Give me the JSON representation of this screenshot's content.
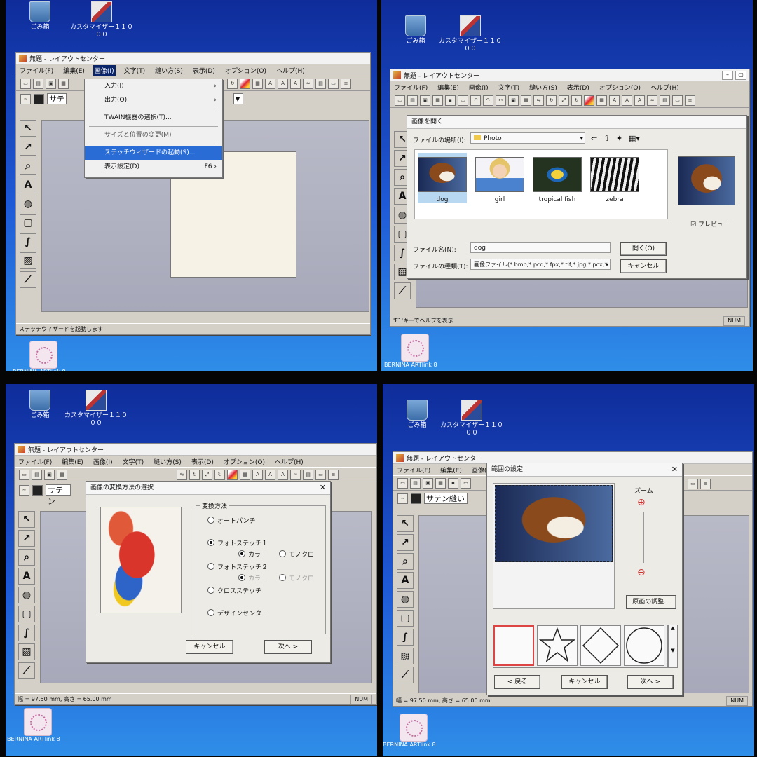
{
  "desktop": {
    "trash_label": "ごみ箱",
    "customizer_label": "カスタマイザー１１０",
    "customizer_sub": "００",
    "artlink_label": "BERNINA ARTlink 8"
  },
  "app": {
    "title": "無題 - レイアウトセンター",
    "menu": [
      "ファイル(F)",
      "編集(E)",
      "画像(I)",
      "文字(T)",
      "縫い方(S)",
      "表示(D)",
      "オプション(O)",
      "ヘルプ(H)"
    ],
    "stitch_combo_full": "サテン縫い",
    "stitch_combo_short": "サテ",
    "stitch_combo_p3": "サテン"
  },
  "panel1": {
    "image_menu": {
      "input": "入力(I)",
      "output": "出力(O)",
      "twain": "TWAIN機器の選択(T)...",
      "size_pos": "サイズと位置の変更(M)",
      "stitch_wizard": "ステッチウィザードの起動(S)...",
      "display": "表示設定(D)",
      "display_key": "F6"
    },
    "status": "ステッチウィザードを起動します"
  },
  "panel2": {
    "dialog_title": "画像を開く",
    "look_in_label": "ファイルの場所(I):",
    "look_in_value": "Photo",
    "files": [
      "dog",
      "girl",
      "tropical fish",
      "zebra"
    ],
    "preview_label": "プレビュー",
    "filename_label": "ファイル名(N):",
    "filename_value": "dog",
    "filetype_label": "ファイルの種類(T):",
    "filetype_value": "画像ファイル(*.bmp;*.pcd;*.fpx;*.tif;*.jpg;*.pcx;*.",
    "open_btn": "開く(O)",
    "cancel_btn": "キャンセル",
    "status": "'F1'キーでヘルプを表示",
    "num": "NUM"
  },
  "panel3": {
    "dialog_title": "画像の変換方法の選択",
    "group_label": "変換方法",
    "opt_auto": "オートパンチ",
    "opt_photo1": "フォトステッチ１",
    "opt_color": "カラー",
    "opt_mono": "モノクロ",
    "opt_photo2": "フォトステッチ２",
    "opt_cross": "クロスステッチ",
    "opt_design": "デザインセンター",
    "cancel_btn": "キャンセル",
    "next_btn": "次へ >",
    "status": "幅 = 97.50 mm, 高さ = 65.00 mm",
    "num": "NUM"
  },
  "panel4": {
    "dialog_title": "範囲の設定",
    "zoom_label": "ズーム",
    "adjust_btn": "原画の調整...",
    "back_btn": "< 戻る",
    "cancel_btn": "キャンセル",
    "next_btn": "次へ >",
    "status": "幅 = 97.50 mm, 高さ = 65.00 mm",
    "num": "NUM"
  },
  "colors": {
    "desktop_top": "#0f2c9a",
    "desktop_bottom": "#2f8ee8",
    "menu_highlight": "#2a6cd6",
    "window_face": "#d4d0c8"
  }
}
